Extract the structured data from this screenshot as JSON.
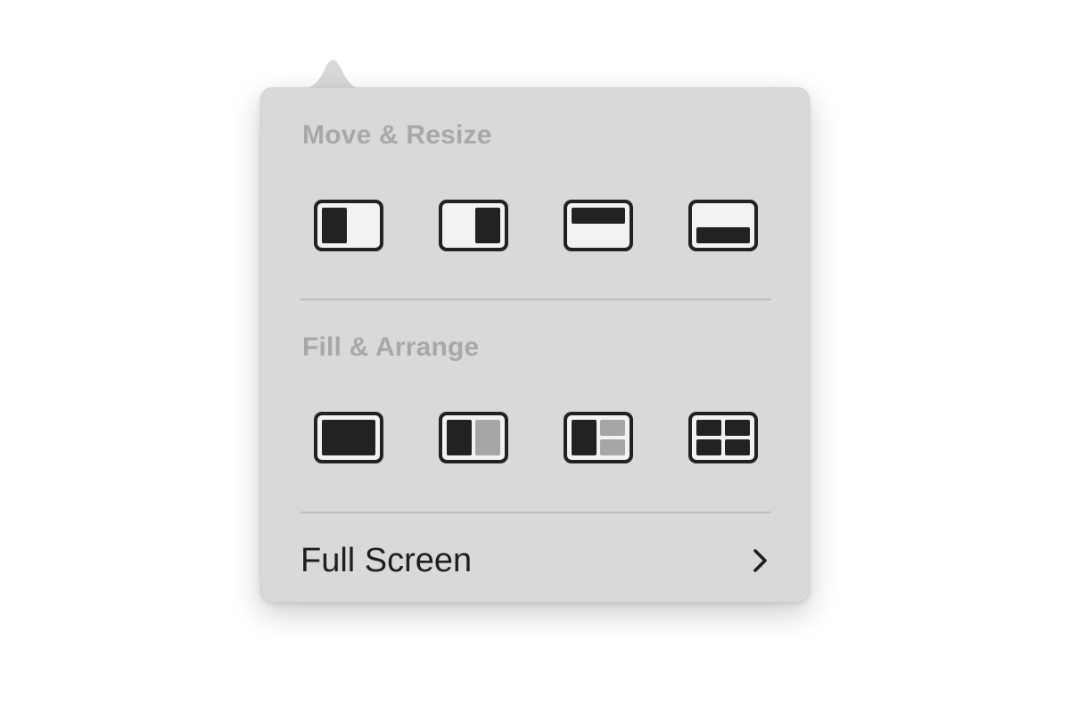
{
  "menu": {
    "move_resize_title": "Move & Resize",
    "fill_arrange_title": "Fill & Arrange",
    "full_screen_label": "Full Screen",
    "move_resize_icons": [
      "left-half-tile-icon",
      "right-half-tile-icon",
      "top-half-tile-icon",
      "bottom-half-tile-icon"
    ],
    "fill_arrange_icons": [
      "fill-screen-icon",
      "split-two-icon",
      "split-three-icon",
      "grid-four-icon"
    ],
    "chevron_icon": "chevron-right-icon"
  },
  "colors": {
    "popover_background": "#d9d9d9",
    "section_title": "#a8a8a8",
    "icon_dark": "#222222",
    "icon_light": "#a6a6a6",
    "label_text": "#1f1f1f",
    "divider": "#bdbdbd"
  }
}
